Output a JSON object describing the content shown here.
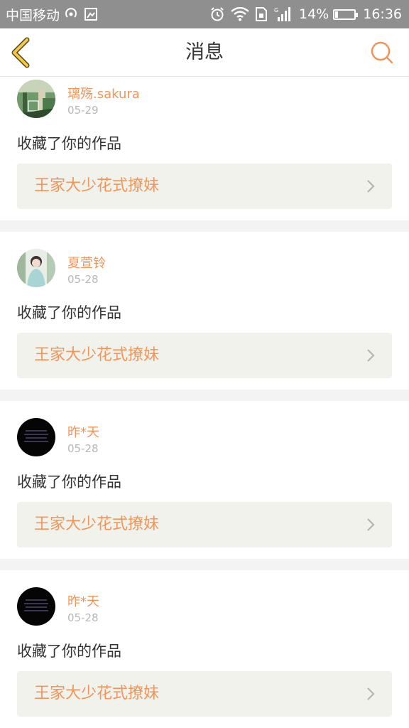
{
  "status_bar": {
    "carrier": "中国移动",
    "battery_percent": "14%",
    "battery_level": 0.14,
    "time": "16:36",
    "icons": [
      "hotspot-icon",
      "screenshot-icon",
      "alarm-icon",
      "wifi-icon",
      "sim-icon",
      "signal-icon",
      "battery-icon"
    ],
    "signal_label": "G"
  },
  "header": {
    "title": "消息",
    "back_icon": "chevron-left-icon",
    "search_icon": "search-icon",
    "accent_color": "#f0965a",
    "back_color": "#f2c94c"
  },
  "messages": [
    {
      "username": "璃殇.sakura",
      "date": "05-29",
      "action": "收藏了你的作品",
      "work_title": "王家大少花式撩妹",
      "avatar": "avatar-green-street"
    },
    {
      "username": "夏萱铃",
      "date": "05-28",
      "action": "收藏了你的作品",
      "work_title": "王家大少花式撩妹",
      "avatar": "avatar-girl-light"
    },
    {
      "username": "昨*天",
      "date": "05-28",
      "action": "收藏了你的作品",
      "work_title": "王家大少花式撩妹",
      "avatar": "avatar-dark-text"
    },
    {
      "username": "昨*天",
      "date": "05-28",
      "action": "收藏了你的作品",
      "work_title": "王家大少花式撩妹",
      "avatar": "avatar-dark-text"
    }
  ]
}
